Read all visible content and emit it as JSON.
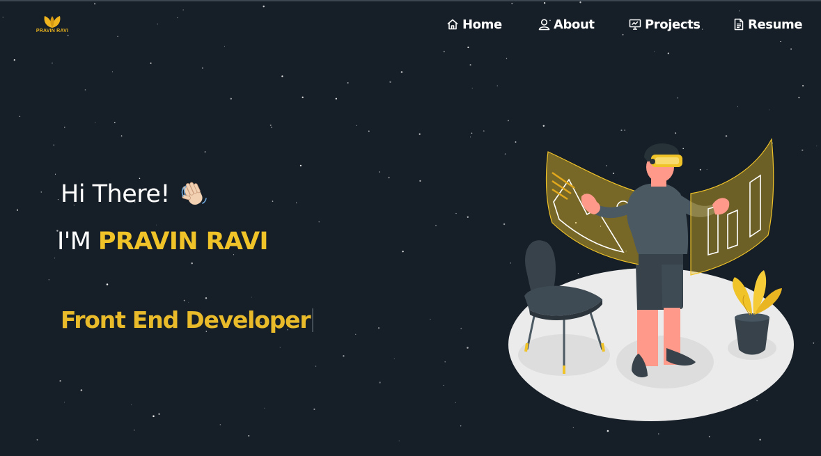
{
  "brand": {
    "logo_text": "PRAVIN RAVI",
    "accent": "#f0c329"
  },
  "nav": {
    "items": [
      {
        "label": "Home",
        "icon": "home-icon"
      },
      {
        "label": "About",
        "icon": "user-icon"
      },
      {
        "label": "Projects",
        "icon": "presentation-icon"
      },
      {
        "label": "Resume",
        "icon": "document-icon"
      }
    ]
  },
  "hero": {
    "greeting": "Hi There!",
    "name_prefix": "I'M",
    "name": "PRAVIN RAVI",
    "role": "Front End Developer",
    "wave_icon": "waving-hand-icon",
    "illustration": "vr-developer-illustration"
  },
  "colors": {
    "background": "#161e27",
    "accent": "#f0c329",
    "text": "#ffffff",
    "floor": "#ebebeb"
  }
}
